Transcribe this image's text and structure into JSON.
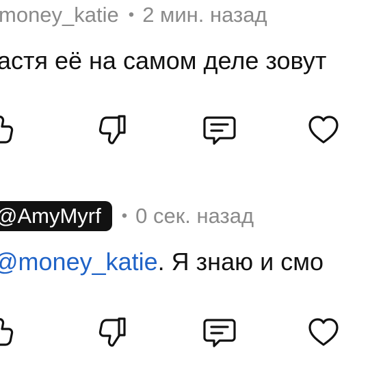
{
  "comments": [
    {
      "author": "money_katie",
      "separator": "•",
      "time": "2 мин. назад",
      "text": "астя её на самом деле зовут",
      "mention": "",
      "actions": {
        "like_icon": "thumbs-up-icon",
        "dislike_icon": "thumbs-down-icon",
        "reply_icon": "comment-icon",
        "favorite_icon": "heart-icon"
      }
    },
    {
      "author": "@AmyMyrf",
      "separator": "•",
      "time": "0 сек. назад",
      "mention": "@money_katie",
      "text": ". Я знаю и смо",
      "actions": {
        "like_icon": "thumbs-up-icon",
        "dislike_icon": "thumbs-down-icon",
        "reply_icon": "comment-icon",
        "favorite_icon": "heart-icon"
      }
    }
  ],
  "colors": {
    "meta_gray": "#8a8a8a",
    "badge_bg": "#121212",
    "mention_blue": "#1f63c7",
    "text": "#111111"
  }
}
